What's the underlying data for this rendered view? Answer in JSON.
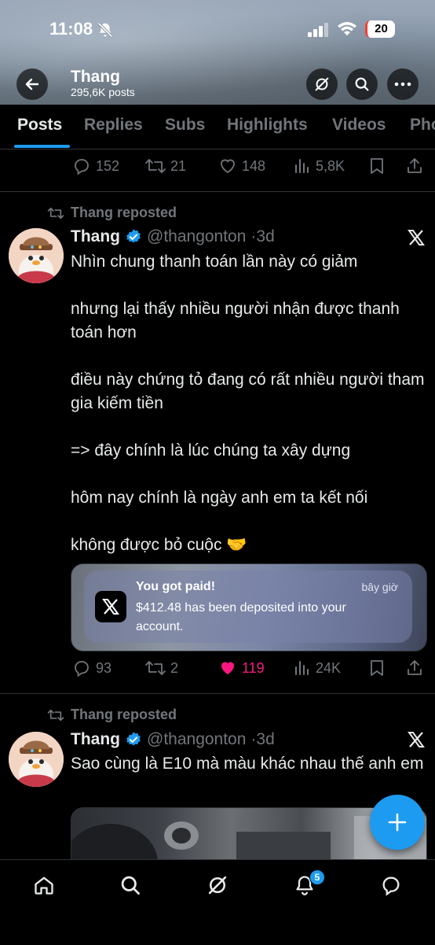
{
  "status_bar": {
    "time": "11:08",
    "battery": "20"
  },
  "profile": {
    "name": "Thang",
    "posts_count": "295,6K posts"
  },
  "tabs": [
    {
      "label": "Posts",
      "active": true
    },
    {
      "label": "Replies"
    },
    {
      "label": "Subs"
    },
    {
      "label": "Highlights"
    },
    {
      "label": "Videos"
    },
    {
      "label": "Pho"
    }
  ],
  "prev_tweet_actions": {
    "replies": "152",
    "reposts": "21",
    "likes": "148",
    "views": "5,8K"
  },
  "tweets": [
    {
      "repost_label": "Thang reposted",
      "name": "Thang",
      "handle": "@thangonton",
      "time": "·3d",
      "paragraphs": [
        "Nhìn chung thanh toán lần này có giảm",
        "nhưng lại thấy nhiều người nhận được thanh toán hơn",
        "điều này chứng tỏ đang có rất nhiều người tham gia kiếm tiền",
        "=> đây chính là lúc chúng ta xây dựng",
        "hôm nay chính là ngày anh em ta kết nối",
        "không được bỏ cuộc 🤝"
      ],
      "notification": {
        "title": "You got paid!",
        "time": "bây giờ",
        "body": "$412.48 has been deposited into your account."
      },
      "actions": {
        "replies": "93",
        "reposts": "2",
        "likes": "119",
        "views": "24K",
        "liked": true
      }
    },
    {
      "repost_label": "Thang reposted",
      "name": "Thang",
      "handle": "@thangonton",
      "time": "·3d",
      "paragraphs": [
        "Sao cùng là E10 mà màu khác nhau thế anh em"
      ]
    }
  ],
  "bottom_nav": {
    "notifications_badge": "5"
  },
  "colors": {
    "accent": "#1d9bf0",
    "like": "#f91880",
    "muted": "#71767b",
    "background": "#000000"
  }
}
